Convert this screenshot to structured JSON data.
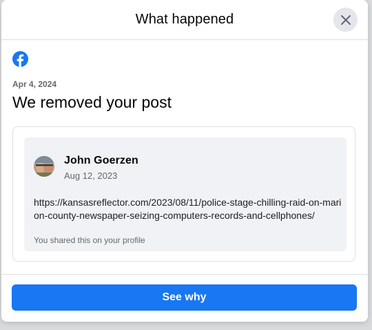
{
  "dialog": {
    "title": "What happened",
    "close_icon": "close-icon"
  },
  "notice": {
    "platform_icon": "facebook-icon",
    "date": "Apr 4, 2024",
    "headline": "We removed your post"
  },
  "post": {
    "author": "John Goerzen",
    "date": "Aug 12, 2023",
    "link": "https://kansasreflector.com/2023/08/11/police-stage-chilling-raid-on-marion-county-newspaper-seizing-computers-records-and-cellphones/",
    "shared_note": "You shared this on your profile"
  },
  "footer": {
    "button_label": "See why"
  },
  "colors": {
    "primary": "#1877f2",
    "text": "#050505",
    "secondary_text": "#65676b",
    "post_bg": "#f0f2f5"
  }
}
